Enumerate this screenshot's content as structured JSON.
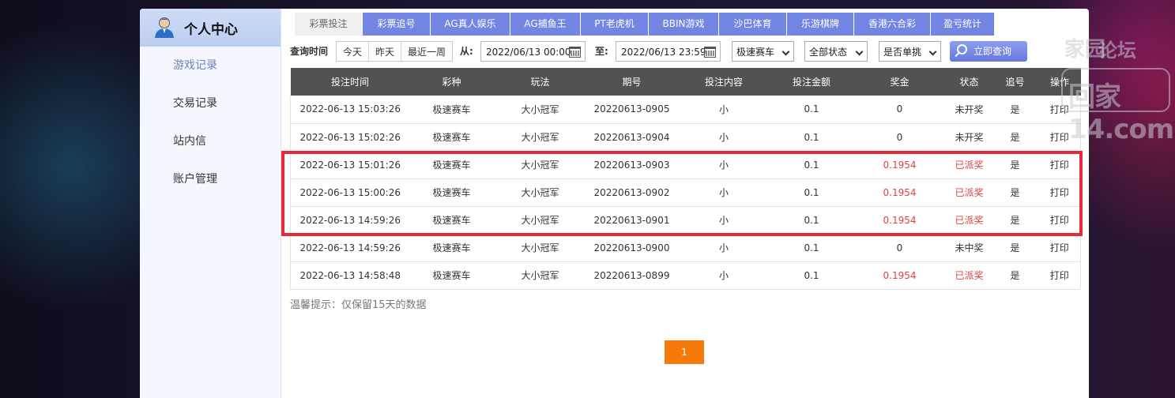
{
  "sidebar": {
    "title": "个人中心",
    "items": [
      {
        "label": "游戏记录"
      },
      {
        "label": "交易记录"
      },
      {
        "label": "站内信"
      },
      {
        "label": "账户管理"
      }
    ]
  },
  "tabs": [
    {
      "label": "彩票投注"
    },
    {
      "label": "彩票追号"
    },
    {
      "label": "AG真人娱乐"
    },
    {
      "label": "AG捕鱼王"
    },
    {
      "label": "PT老虎机"
    },
    {
      "label": "BBIN游戏"
    },
    {
      "label": "沙巴体育"
    },
    {
      "label": "乐游棋牌"
    },
    {
      "label": "香港六合彩"
    },
    {
      "label": "盈亏统计"
    }
  ],
  "filter": {
    "label": "查询时间",
    "quick": [
      "今天",
      "昨天",
      "最近一周"
    ],
    "from_label": "从:",
    "from_value": "2022/06/13 00:00",
    "to_label": "至:",
    "to_value": "2022/06/13 23:59",
    "game_select": "极速赛车",
    "status_select": "全部状态",
    "single_select": "是否单挑",
    "query_button": "立即查询"
  },
  "table": {
    "headers": [
      "投注时间",
      "彩种",
      "玩法",
      "期号",
      "投注内容",
      "投注金额",
      "奖金",
      "状态",
      "追号",
      "操作"
    ],
    "rows": [
      [
        "2022-06-13 15:03:26",
        "极速赛车",
        "大小冠军",
        "20220613-0905",
        "小",
        "0.1",
        "0",
        "未开奖",
        "是",
        "打印"
      ],
      [
        "2022-06-13 15:02:26",
        "极速赛车",
        "大小冠军",
        "20220613-0904",
        "小",
        "0.1",
        "0",
        "未开奖",
        "是",
        "打印"
      ],
      [
        "2022-06-13 15:01:26",
        "极速赛车",
        "大小冠军",
        "20220613-0903",
        "小",
        "0.1",
        "0.1954",
        "已派奖",
        "是",
        "打印"
      ],
      [
        "2022-06-13 15:00:26",
        "极速赛车",
        "大小冠军",
        "20220613-0902",
        "小",
        "0.1",
        "0.1954",
        "已派奖",
        "是",
        "打印"
      ],
      [
        "2022-06-13 14:59:26",
        "极速赛车",
        "大小冠军",
        "20220613-0901",
        "小",
        "0.1",
        "0.1954",
        "已派奖",
        "是",
        "打印"
      ],
      [
        "2022-06-13 14:59:26",
        "极速赛车",
        "大小冠军",
        "20220613-0900",
        "小",
        "0.1",
        "0",
        "未中奖",
        "是",
        "打印"
      ],
      [
        "2022-06-13 14:58:48",
        "极速赛车",
        "大小冠军",
        "20220613-0899",
        "小",
        "0.1",
        "0.1954",
        "已派奖",
        "是",
        "打印"
      ]
    ]
  },
  "tip": "温馨提示：仅保留15天的数据",
  "pagination": {
    "current": "1"
  },
  "watermark": {
    "line1a": "家园",
    "line1b": "论坛",
    "line2": "回家14.com"
  },
  "colors": {
    "accent": "#7285e3",
    "paid": "#e34040",
    "page": "#f57a0a",
    "highlight": "#e8293a"
  }
}
